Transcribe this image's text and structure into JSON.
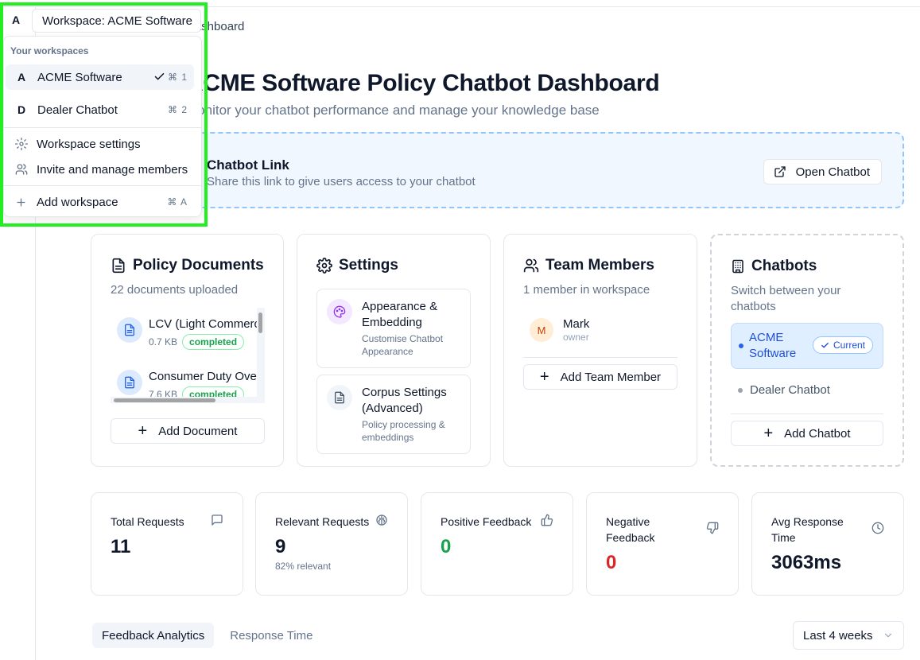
{
  "breadcrumb": {
    "current": "Dashboard"
  },
  "page": {
    "title": "ACME Software Policy Chatbot Dashboard",
    "subtitle": "Monitor your chatbot performance and manage your knowledge base"
  },
  "share_link": {
    "title": "Chatbot Link",
    "description": "Share this link to give users access to your chatbot",
    "open_button": "Open Chatbot"
  },
  "policy_documents": {
    "title": "Policy Documents",
    "subtitle": "22 documents uploaded",
    "items": [
      {
        "name": "LCV (Light Commercial Vehicle) Policy",
        "size": "0.7 KB",
        "status": "completed"
      },
      {
        "name": "Consumer Duty Overview",
        "size": "7.6 KB",
        "status": "completed"
      }
    ],
    "add_button": "Add Document"
  },
  "settings": {
    "title": "Settings",
    "items": [
      {
        "title": "Appearance & Embedding",
        "description": "Customise Chatbot Appearance"
      },
      {
        "title": "Corpus Settings (Advanced)",
        "description": "Policy processing & embeddings"
      }
    ]
  },
  "team": {
    "title": "Team Members",
    "subtitle": "1 member in workspace",
    "members": [
      {
        "initial": "M",
        "name": "Mark",
        "role": "owner"
      }
    ],
    "add_button": "Add Team Member"
  },
  "chatbots": {
    "title": "Chatbots",
    "subtitle": "Switch between your chatbots",
    "current": {
      "name": "ACME Software",
      "badge": "Current"
    },
    "others": [
      "Dealer Chatbot"
    ],
    "add_button": "Add Chatbot"
  },
  "stats": [
    {
      "label": "Total Requests",
      "value": "11",
      "note": "",
      "icon": "message-square-icon"
    },
    {
      "label": "Relevant Requests",
      "value": "9",
      "note": "82% relevant",
      "icon": "brain-icon"
    },
    {
      "label": "Positive Feedback",
      "value": "0",
      "note": "",
      "icon": "thumbs-up-icon"
    },
    {
      "label": "Negative Feedback",
      "value": "0",
      "note": "",
      "icon": "thumbs-down-icon"
    },
    {
      "label": "Avg Response Time",
      "value": "3063ms",
      "note": "",
      "icon": "clock-icon"
    }
  ],
  "tabs": [
    {
      "label": "Feedback Analytics",
      "active": true
    },
    {
      "label": "Response Time",
      "active": false
    }
  ],
  "range_select": {
    "value": "Last 4 weeks"
  },
  "workspace_switcher": {
    "avatar": "A",
    "label": "Workspace: ACME Software",
    "heading": "Your workspaces",
    "workspaces": [
      {
        "initial": "A",
        "name": "ACME Software",
        "shortcut": "⌘ 1",
        "selected": true
      },
      {
        "initial": "D",
        "name": "Dealer Chatbot",
        "shortcut": "⌘ 2",
        "selected": false
      }
    ],
    "actions": [
      {
        "label": "Workspace settings",
        "icon": "gear-icon"
      },
      {
        "label": "Invite and manage members",
        "icon": "users-icon"
      }
    ],
    "add": {
      "label": "Add workspace",
      "shortcut": "⌘ A"
    }
  },
  "colors": {
    "accent_blue": "#1d4ed8",
    "positive": "#16a34a",
    "negative": "#dc2626",
    "highlight": "#22ee22"
  }
}
